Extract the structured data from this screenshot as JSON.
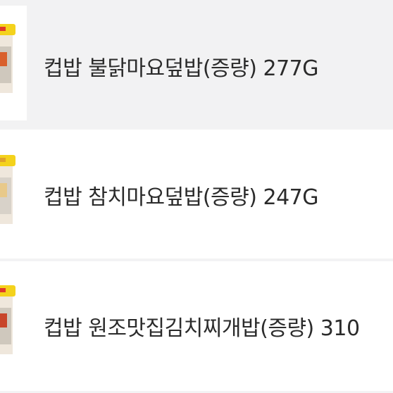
{
  "products": [
    {
      "name": "컵밥 불닭마요덮밥(증량) 277G"
    },
    {
      "name": "컵밥 참치마요덮밥(증량) 247G"
    },
    {
      "name": "컵밥 원조맛집김치찌개밥(증량) 310"
    }
  ]
}
